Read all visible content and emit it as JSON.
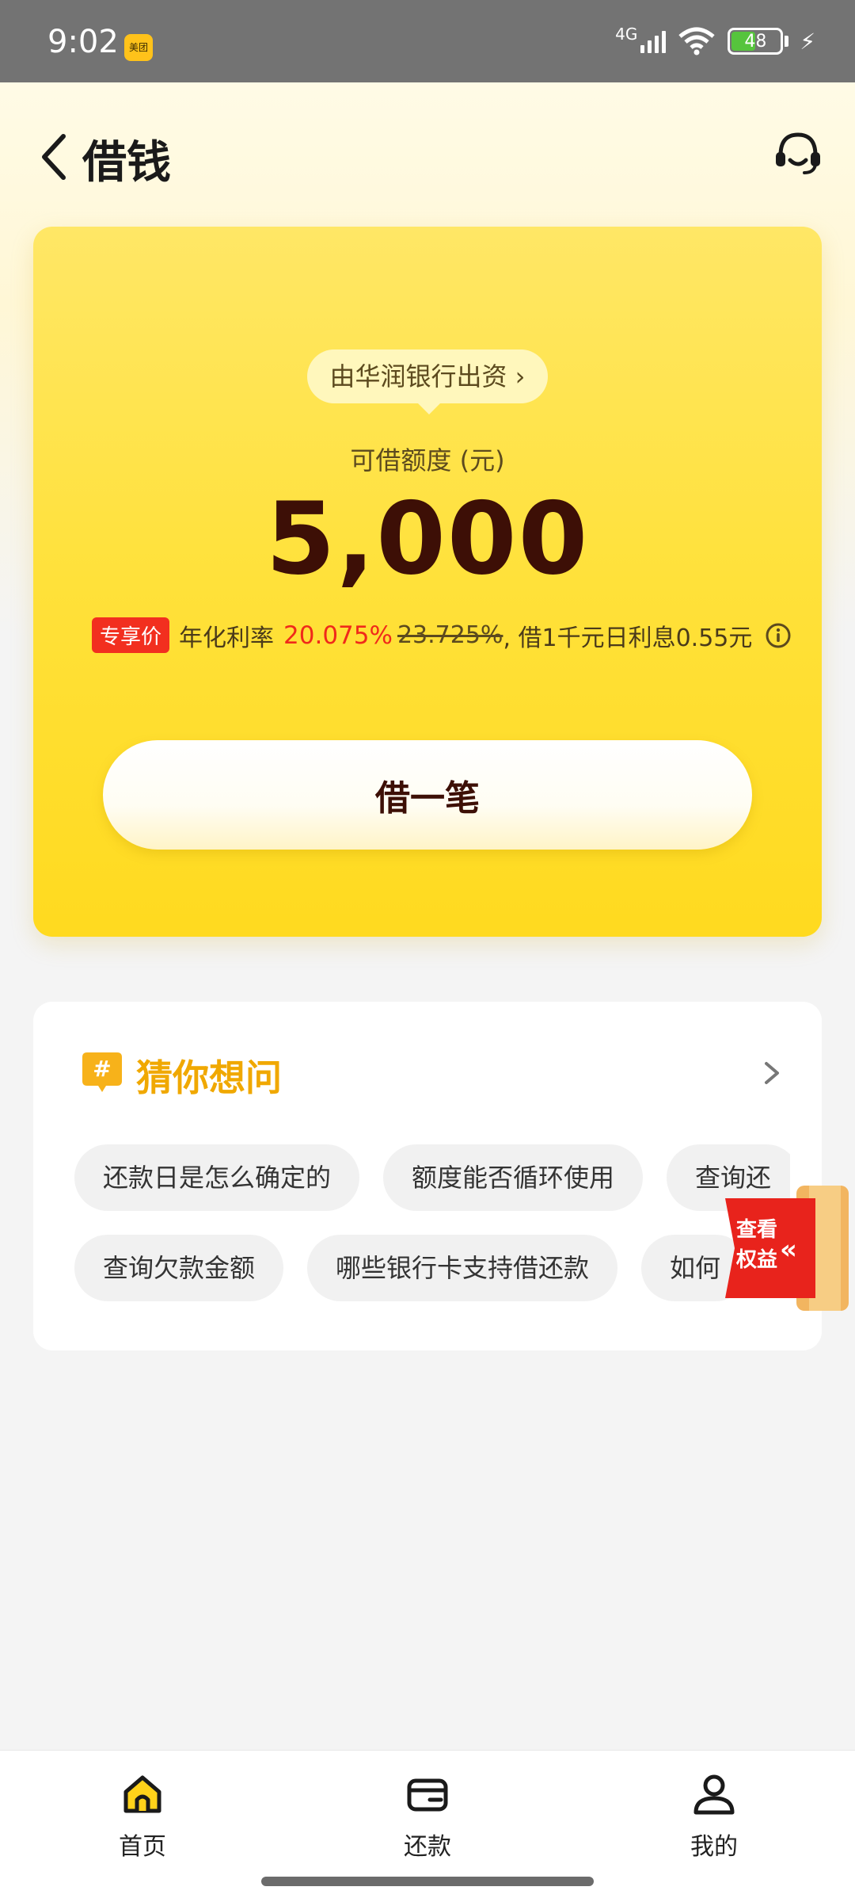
{
  "status_bar": {
    "time": "9:02",
    "app_badge": "美团",
    "network": "4G",
    "battery": "48"
  },
  "header": {
    "title": "借钱"
  },
  "loan_card": {
    "funder": "由华润银行出资 ›",
    "quota_label": "可借额度 (元)",
    "quota_amount": "5,000",
    "rate_badge": "专享价",
    "rate_label": "年化利率",
    "rate_current": "20.075%",
    "rate_original": "23.725%",
    "rate_note": ", 借1千元日利息0.55元",
    "cta": "借一笔"
  },
  "faq": {
    "title": "猜你想问",
    "row1": [
      "还款日是怎么确定的",
      "额度能否循环使用",
      "查询还"
    ],
    "row2": [
      "查询欠款金额",
      "哪些银行卡支持借还款",
      "如何"
    ]
  },
  "benefit_float": {
    "label": "查看权益"
  },
  "bottom_nav": {
    "items": [
      {
        "label": "首页"
      },
      {
        "label": "还款"
      },
      {
        "label": "我的"
      }
    ]
  },
  "colors": {
    "accent_yellow": "#ffe13a",
    "price_red": "#f02a1a",
    "faq_title": "#f0a800",
    "amount_dark": "#3d0f06"
  }
}
